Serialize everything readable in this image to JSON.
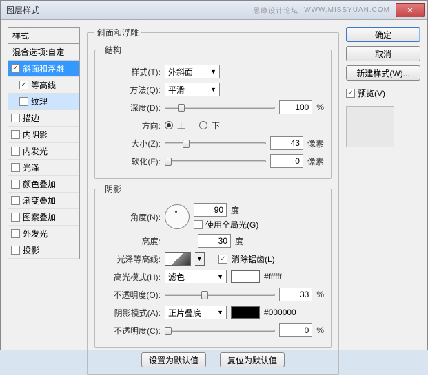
{
  "title": "图层样式",
  "watermark": "思缘设计论坛",
  "watermark2": "WWW.MISSYUAN.COM",
  "close": "✕",
  "sidebar": {
    "header": "样式",
    "blend": "混合选项:自定",
    "items": [
      {
        "label": "斜面和浮雕",
        "checked": true,
        "selected": true
      },
      {
        "label": "等高线",
        "checked": true,
        "sub": true
      },
      {
        "label": "纹理",
        "checked": false,
        "sub": true,
        "highlight": true
      },
      {
        "label": "描边",
        "checked": false
      },
      {
        "label": "内阴影",
        "checked": false
      },
      {
        "label": "内发光",
        "checked": false
      },
      {
        "label": "光泽",
        "checked": false
      },
      {
        "label": "颜色叠加",
        "checked": false
      },
      {
        "label": "渐变叠加",
        "checked": false
      },
      {
        "label": "图案叠加",
        "checked": false
      },
      {
        "label": "外发光",
        "checked": false
      },
      {
        "label": "投影",
        "checked": false
      }
    ]
  },
  "main": {
    "panel_title": "斜面和浮雕",
    "structure": {
      "legend": "结构",
      "style_lbl": "样式(T):",
      "style_val": "外斜面",
      "technique_lbl": "方法(Q):",
      "technique_val": "平滑",
      "depth_lbl": "深度(D):",
      "depth_val": "100",
      "depth_unit": "%",
      "direction_lbl": "方向:",
      "up": "上",
      "down": "下",
      "size_lbl": "大小(Z):",
      "size_val": "43",
      "size_unit": "像素",
      "soften_lbl": "软化(F):",
      "soften_val": "0",
      "soften_unit": "像素"
    },
    "shading": {
      "legend": "阴影",
      "angle_lbl": "角度(N):",
      "angle_val": "90",
      "angle_unit": "度",
      "global_light": "使用全局光(G)",
      "altitude_lbl": "高度:",
      "altitude_val": "30",
      "altitude_unit": "度",
      "gloss_lbl": "光泽等高线:",
      "antialias": "消除锯齿(L)",
      "highlight_mode_lbl": "高光模式(H):",
      "highlight_mode_val": "滤色",
      "highlight_color": "#ffffff",
      "highlight_opacity_lbl": "不透明度(O):",
      "highlight_opacity_val": "33",
      "opacity_unit": "%",
      "shadow_mode_lbl": "阴影模式(A):",
      "shadow_mode_val": "正片叠底",
      "shadow_color": "#000000",
      "shadow_opacity_lbl": "不透明度(C):",
      "shadow_opacity_val": "0"
    },
    "footer": {
      "default_btn": "设置为默认值",
      "reset_btn": "复位为默认值"
    }
  },
  "right": {
    "ok": "确定",
    "cancel": "取消",
    "new_style": "新建样式(W)...",
    "preview_lbl": "预览(V)"
  }
}
